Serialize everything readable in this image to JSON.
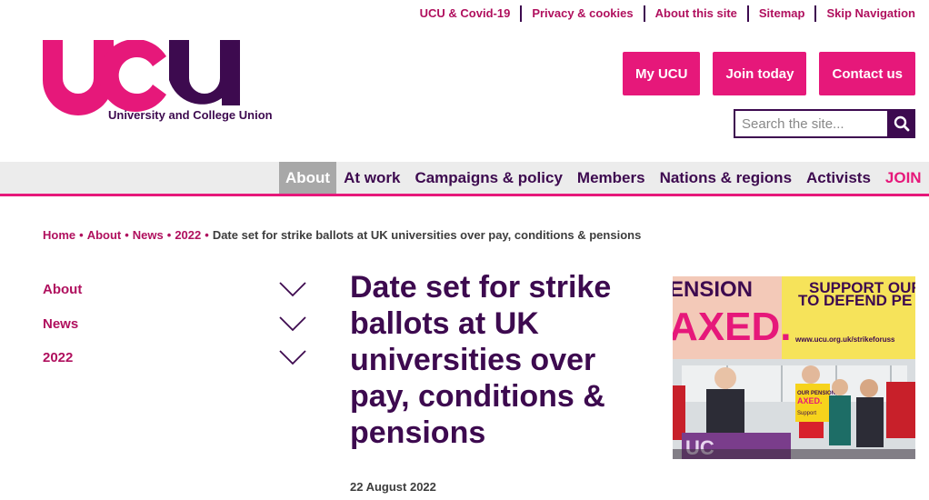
{
  "utility_nav": [
    "UCU & Covid-19",
    "Privacy & cookies",
    "About this site",
    "Sitemap",
    "Skip Navigation"
  ],
  "logo": {
    "letters": "ucu",
    "tagline": "University and College Union"
  },
  "header_buttons": {
    "my_ucu": "My UCU",
    "join_today": "Join today",
    "contact_us": "Contact us"
  },
  "search": {
    "placeholder": "Search the site..."
  },
  "main_nav": [
    "About",
    "At work",
    "Campaigns & policy",
    "Members",
    "Nations & regions",
    "Activists",
    "JOIN"
  ],
  "breadcrumb": {
    "items": [
      "Home",
      "About",
      "News",
      "2022"
    ],
    "current": "Date set for strike ballots at UK universities over pay, conditions & pensions"
  },
  "side_menu": [
    "About",
    "News",
    "2022"
  ],
  "article": {
    "title": "Date set for strike ballots at UK universities over pay, conditions & pensions",
    "date": "22 August 2022"
  },
  "hero_image": {
    "banner_line1": "ENSION",
    "banner_line2": "AXED.",
    "banner_right1": "SUPPORT OUR",
    "banner_right2": "TO DEFEND PE",
    "banner_url": "www.ucu.org.uk/strikeforuss",
    "placard1": "OUR PENSION",
    "placard2": "AXED.",
    "placard3": "Support",
    "flag": "UC"
  },
  "colors": {
    "brand_pink": "#e6187a",
    "brand_purple": "#3d0a4f",
    "link_magenta": "#b0105e"
  },
  "icons": {
    "search": "search-icon",
    "expand": "chevron-down-icon"
  }
}
